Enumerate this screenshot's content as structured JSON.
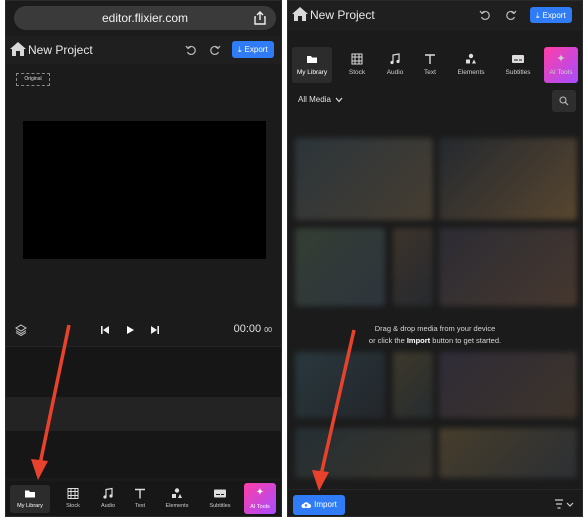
{
  "browser": {
    "url": "editor.flixier.com"
  },
  "project": {
    "title": "New Project",
    "export_label": "Export"
  },
  "preview": {
    "aspect_label": "Original",
    "timecode_main": "00:00",
    "timecode_frac": "00"
  },
  "bottom_nav": {
    "items": [
      {
        "label": "My Library",
        "icon": "folder-icon"
      },
      {
        "label": "Stock",
        "icon": "film-icon"
      },
      {
        "label": "Audio",
        "icon": "music-icon"
      },
      {
        "label": "Text",
        "icon": "text-icon"
      },
      {
        "label": "Elements",
        "icon": "shapes-icon"
      },
      {
        "label": "Subtitles",
        "icon": "subtitles-icon"
      },
      {
        "label": "AI Tools",
        "icon": "sparkle-icon"
      }
    ]
  },
  "library": {
    "filter_label": "All Media",
    "empty_line1": "Drag & drop media from your device",
    "empty_line2_pre": "or click the ",
    "empty_line2_bold": "Import",
    "empty_line2_post": " button to get started.",
    "import_label": "Import"
  },
  "colors": {
    "accent": "#2f7cf6",
    "panel_bg": "#1b1b1b",
    "arrow": "#e8412c"
  }
}
